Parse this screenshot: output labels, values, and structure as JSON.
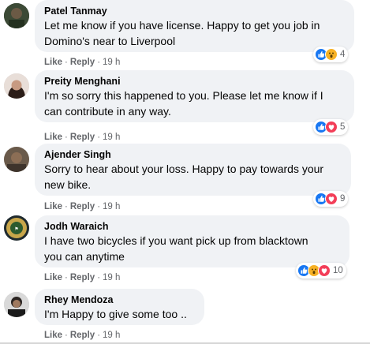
{
  "comments": [
    {
      "author": "Patel Tanmay",
      "text": "Let me know if you have license. Happy to get you job in\nDomino's near to Liverpool",
      "like": "Like",
      "reply": "Reply",
      "time": "19 h",
      "reaction_count": "4",
      "reactions": [
        "like-icon",
        "wow-icon"
      ]
    },
    {
      "author": "Preity Menghani",
      "text": "I'm so sorry this happened to you. Please let me know if I\ncan contribute in any way.",
      "like": "Like",
      "reply": "Reply",
      "time": "19 h",
      "reaction_count": "5",
      "reactions": [
        "like-icon",
        "love-icon"
      ]
    },
    {
      "author": "Ajender Singh",
      "text": "Sorry to hear about your loss. Happy to pay towards your\nnew bike.",
      "like": "Like",
      "reply": "Reply",
      "time": "19 h",
      "reaction_count": "9",
      "reactions": [
        "like-icon",
        "love-icon"
      ]
    },
    {
      "author": "Jodh Waraich",
      "text": "I have two bicycles if you want pick up from blacktown\nyou can anytime",
      "like": "Like",
      "reply": "Reply",
      "time": "19 h",
      "reaction_count": "10",
      "reactions": [
        "like-icon",
        "wow-icon",
        "love-icon"
      ]
    },
    {
      "author": "Rhey Mendoza",
      "text": "I'm Happy to give some too ..",
      "like": "Like",
      "reply": "Reply",
      "time": "19 h"
    }
  ],
  "colors": {
    "bubble": "#f0f2f5",
    "meta_text": "#65676b",
    "like_blue": "#1877f2",
    "love_red": "#f33e58",
    "wow_yellow": "#f7b125"
  }
}
